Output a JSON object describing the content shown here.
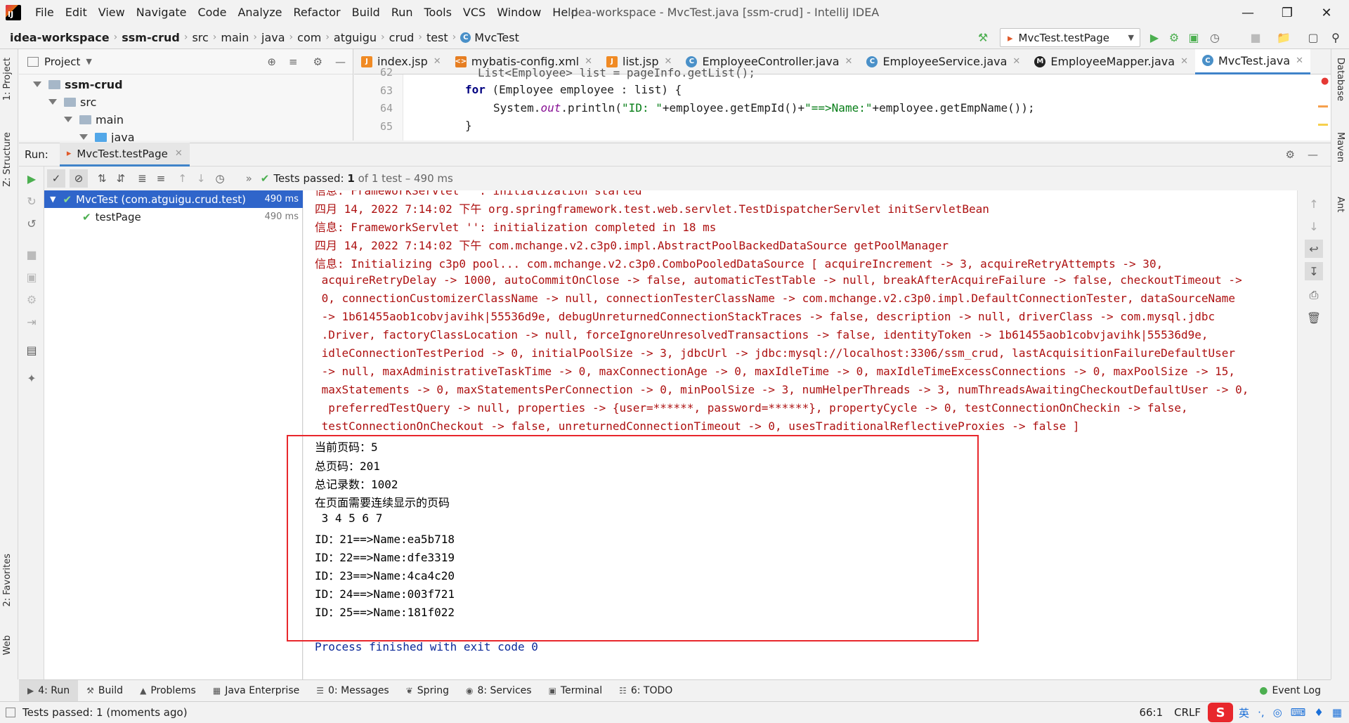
{
  "app": {
    "menu": [
      "File",
      "Edit",
      "View",
      "Navigate",
      "Code",
      "Analyze",
      "Refactor",
      "Build",
      "Run",
      "Tools",
      "VCS",
      "Window",
      "Help"
    ],
    "window_title": "idea-workspace - MvcTest.java [ssm-crud] - IntelliJ IDEA",
    "logo_text": "IJ"
  },
  "breadcrumb": [
    "idea-workspace",
    "ssm-crud",
    "src",
    "main",
    "java",
    "com",
    "atguigu",
    "crud",
    "test",
    "MvcTest"
  ],
  "run_config": "MvcTest.testPage",
  "left_strip": {
    "project": "1: Project",
    "structure": "Z: Structure",
    "favorites": "2: Favorites",
    "web": "Web"
  },
  "right_strip": {
    "database": "Database",
    "maven": "Maven",
    "ant": "Ant"
  },
  "project_panel": {
    "title": "Project",
    "tree": [
      {
        "label": "ssm-crud",
        "depth": 0,
        "bold": true
      },
      {
        "label": "src",
        "depth": 1,
        "bold": false
      },
      {
        "label": "main",
        "depth": 2,
        "bold": false
      },
      {
        "label": "java",
        "depth": 3,
        "bold": false
      }
    ]
  },
  "editor": {
    "tabs": [
      {
        "label": "index.jsp",
        "type": "jsp"
      },
      {
        "label": "mybatis-config.xml",
        "type": "xml"
      },
      {
        "label": "list.jsp",
        "type": "jsp"
      },
      {
        "label": "EmployeeController.java",
        "type": "class"
      },
      {
        "label": "EmployeeService.java",
        "type": "class"
      },
      {
        "label": "EmployeeMapper.java",
        "type": "mapper"
      },
      {
        "label": "MvcTest.java",
        "type": "class",
        "active": true
      }
    ],
    "line_numbers": [
      "62",
      "63",
      "64",
      "65"
    ],
    "code": {
      "line62": "List<Employee> list = pageInfo.getList();",
      "line63_kw": "for",
      "line63_rest": " (Employee employee : list) {",
      "line64_a": "System.",
      "line64_field": "out",
      "line64_b": ".println(",
      "line64_str1": "\"ID: \"",
      "line64_c": "+employee.getEmpId()+",
      "line64_str2": "\"==>Name:\"",
      "line64_d": "+employee.getEmpName());",
      "line65": "}"
    }
  },
  "run_panel": {
    "label": "Run:",
    "tab": "MvcTest.testPage",
    "status_bold": "Tests passed:",
    "status_count": "1",
    "status_rest": "of 1 test – 490 ms",
    "tree": [
      {
        "label": "MvcTest (com.atguigu.crud.test)",
        "time": "490 ms"
      },
      {
        "label": "testPage",
        "time": "490 ms"
      }
    ]
  },
  "console": {
    "lines": [
      {
        "text": "信息: FrameworkServlet '': initialization started",
        "style": "red"
      },
      {
        "text": "四月 14, 2022 7:14:02 下午 org.springframework.test.web.servlet.TestDispatcherServlet initServletBean",
        "style": "red"
      },
      {
        "text": "信息: FrameworkServlet '': initialization completed in 18 ms",
        "style": "red"
      },
      {
        "text": "四月 14, 2022 7:14:02 下午 com.mchange.v2.c3p0.impl.AbstractPoolBackedDataSource getPoolManager",
        "style": "red"
      },
      {
        "text": "信息: Initializing c3p0 pool... com.mchange.v2.c3p0.ComboPooledDataSource [ acquireIncrement -> 3, acquireRetryAttempts -> 30,",
        "style": "red"
      },
      {
        "text": " acquireRetryDelay -> 1000, autoCommitOnClose -> false, automaticTestTable -> null, breakAfterAcquireFailure -> false, checkoutTimeout ->",
        "style": "red"
      },
      {
        "text": " 0, connectionCustomizerClassName -> null, connectionTesterClassName -> com.mchange.v2.c3p0.impl.DefaultConnectionTester, dataSourceName",
        "style": "red"
      },
      {
        "text": " -> 1b61455aob1cobvjavihk|55536d9e, debugUnreturnedConnectionStackTraces -> false, description -> null, driverClass -> com.mysql.jdbc",
        "style": "red"
      },
      {
        "text": " .Driver, factoryClassLocation -> null, forceIgnoreUnresolvedTransactions -> false, identityToken -> 1b61455aob1cobvjavihk|55536d9e,",
        "style": "red"
      },
      {
        "text": " idleConnectionTestPeriod -> 0, initialPoolSize -> 3, jdbcUrl -> jdbc:mysql://localhost:3306/ssm_crud, lastAcquisitionFailureDefaultUser",
        "style": "red"
      },
      {
        "text": " -> null, maxAdministrativeTaskTime -> 0, maxConnectionAge -> 0, maxIdleTime -> 0, maxIdleTimeExcessConnections -> 0, maxPoolSize -> 15,",
        "style": "red"
      },
      {
        "text": " maxStatements -> 0, maxStatementsPerConnection -> 0, minPoolSize -> 3, numHelperThreads -> 3, numThreadsAwaitingCheckoutDefaultUser -> 0,",
        "style": "red"
      },
      {
        "text": "  preferredTestQuery -> null, properties -> {user=******, password=******}, propertyCycle -> 0, testConnectionOnCheckin -> false,",
        "style": "red"
      },
      {
        "text": " testConnectionOnCheckout -> false, unreturnedConnectionTimeout -> 0, usesTraditionalReflectiveProxies -> false ]",
        "style": "red"
      },
      {
        "text": "当前页码：5",
        "style": "plain"
      },
      {
        "text": "总页码：201",
        "style": "plain"
      },
      {
        "text": "总记录数：1002",
        "style": "plain"
      },
      {
        "text": "在页面需要连续显示的页码",
        "style": "plain"
      },
      {
        "text": " 3 4 5 6 7",
        "style": "plain"
      },
      {
        "text": "ID：21==>Name:ea5b718",
        "style": "plain"
      },
      {
        "text": "ID：22==>Name:dfe3319",
        "style": "plain"
      },
      {
        "text": "ID：23==>Name:4ca4c20",
        "style": "plain"
      },
      {
        "text": "ID：24==>Name:003f721",
        "style": "plain"
      },
      {
        "text": "ID：25==>Name:181f022",
        "style": "plain"
      },
      {
        "text": "",
        "style": "plain"
      },
      {
        "text": "Process finished with exit code 0",
        "style": "blue"
      }
    ]
  },
  "bottom_tabs": [
    {
      "label": "4: Run",
      "icon": "play-icon",
      "active": true
    },
    {
      "label": "Build",
      "icon": "hammer-icon"
    },
    {
      "label": "Problems",
      "icon": "warning-icon"
    },
    {
      "label": "Java Enterprise",
      "icon": "enterprise-icon"
    },
    {
      "label": "0: Messages",
      "icon": "messages-icon"
    },
    {
      "label": "Spring",
      "icon": "spring-icon"
    },
    {
      "label": "8: Services",
      "icon": "services-icon"
    },
    {
      "label": "Terminal",
      "icon": "terminal-icon"
    },
    {
      "label": "6: TODO",
      "icon": "todo-icon"
    }
  ],
  "event_log": "Event Log",
  "status": {
    "message": "Tests passed: 1 (moments ago)",
    "position": "66:1",
    "encoding": "CRLF",
    "ime": "英"
  },
  "colors": {
    "accent": "#4083c9",
    "console_red": "#ad1010",
    "highlight_box": "#e8272c",
    "success_green": "#4caf50"
  }
}
